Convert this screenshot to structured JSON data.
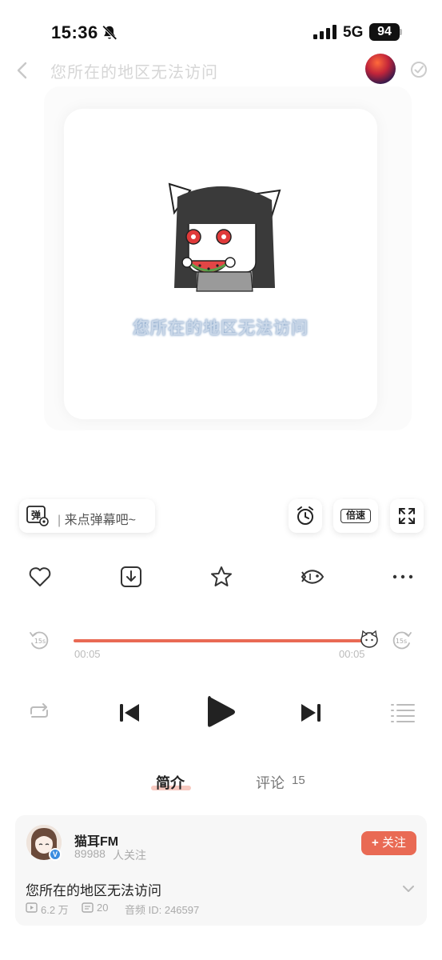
{
  "status_bar": {
    "time": "15:36",
    "network": "5G",
    "battery": "94"
  },
  "header": {
    "title": "您所在的地区无法访问"
  },
  "cover": {
    "text": "您所在的地区无法访问"
  },
  "danmaku": {
    "placeholder": "来点弹幕吧~",
    "icon_label": "弹"
  },
  "tools": {
    "speed_label": "倍速"
  },
  "progress": {
    "current": "00:05",
    "total": "00:05",
    "fraction": 1.0,
    "skip_back": "15s",
    "skip_forward": "15s"
  },
  "tabs": {
    "intro": "简介",
    "comments": "评论",
    "comments_count": "15"
  },
  "uploader": {
    "name": "猫耳FM",
    "followers_count": "89988",
    "followers_label": "人关注",
    "follow_button": "关注"
  },
  "item": {
    "title": "您所在的地区无法访问",
    "plays": "6.2 万",
    "danmaku_count": "20",
    "audio_id": "音频 ID: 246597"
  },
  "colors": {
    "accent": "#e96a54"
  }
}
